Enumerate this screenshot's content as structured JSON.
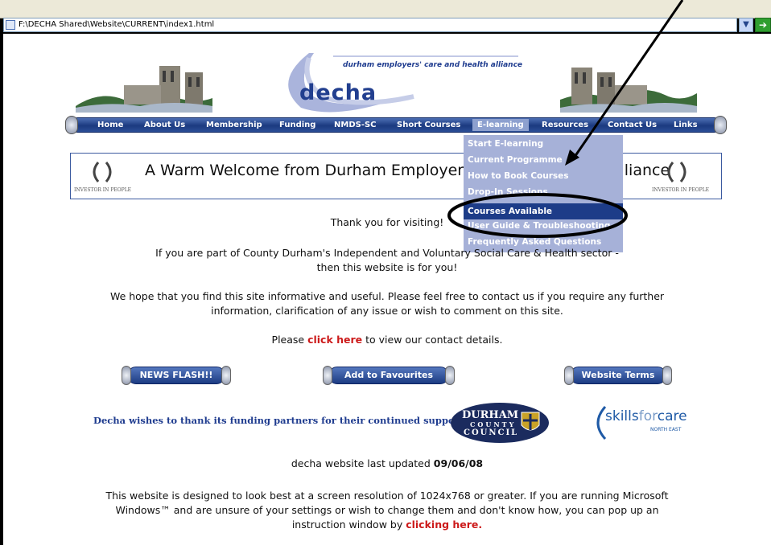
{
  "browser": {
    "address": "F:\\DECHA Shared\\Website\\CURRENT\\index1.html"
  },
  "header": {
    "tagline": "durham employers' care and health alliance",
    "logo_word": "decha"
  },
  "nav": {
    "items": [
      "Home",
      "About Us",
      "Membership",
      "Funding",
      "NMDS-SC",
      "Short Courses",
      "E-learning",
      "Resources",
      "Contact Us",
      "Links"
    ],
    "active": "E-learning"
  },
  "elearning_menu": {
    "items": [
      "Start E-learning",
      "Current Programme",
      "How to Book Courses",
      "Drop-In Sessions",
      "Courses Available",
      "User Guide & Troubleshooting",
      "Frequently Asked Questions"
    ],
    "selected": "Courses Available"
  },
  "banner": {
    "welcome": "A Warm Welcome from Durham Employers' Care and Health Alliance",
    "iip_label": "INVESTOR IN PEOPLE"
  },
  "intro": {
    "thanks": "Thank you for visiting!",
    "sector_line1": "If you are part of County Durham's Independent and Voluntary Social Care & Health sector -",
    "sector_line2": "then this website is for you!",
    "hope_line1": "We hope that you find this site informative and useful.  Please feel free to contact us if you require any further",
    "hope_line2": "information, clarification of any issue or wish to comment on this site.",
    "contact_prefix": "Please ",
    "contact_link": "click here",
    "contact_suffix": " to view our contact details."
  },
  "buttons": {
    "news": "NEWS FLASH!!",
    "favourites": "Add to Favourites",
    "terms": "Website Terms"
  },
  "partners": {
    "thanks": "Decha wishes to thank its funding partners for their continued support",
    "durham_lines": [
      "DURHAM",
      "COUNTY",
      "COUNCIL"
    ],
    "skills_word_a": "skills",
    "skills_word_b": "for",
    "skills_word_c": "care",
    "skills_sub": "NORTH EAST"
  },
  "footer": {
    "updated_prefix": "decha website last updated ",
    "updated_date": "09/06/08",
    "res_line1": "This website is designed to look best at a screen resolution of 1024x768 or greater.  If you are running Microsoft",
    "res_line2": "Windows™ and are unsure of your settings or wish to change them and don't know how, you can pop up an",
    "res_line3_prefix": "instruction window by ",
    "res_link": "clicking here."
  },
  "colors": {
    "nav_blue": "#1b3a80",
    "menu_bg": "#a6b1d8",
    "selected_bg": "#1d3c88",
    "link_red": "#cc1a1a"
  }
}
